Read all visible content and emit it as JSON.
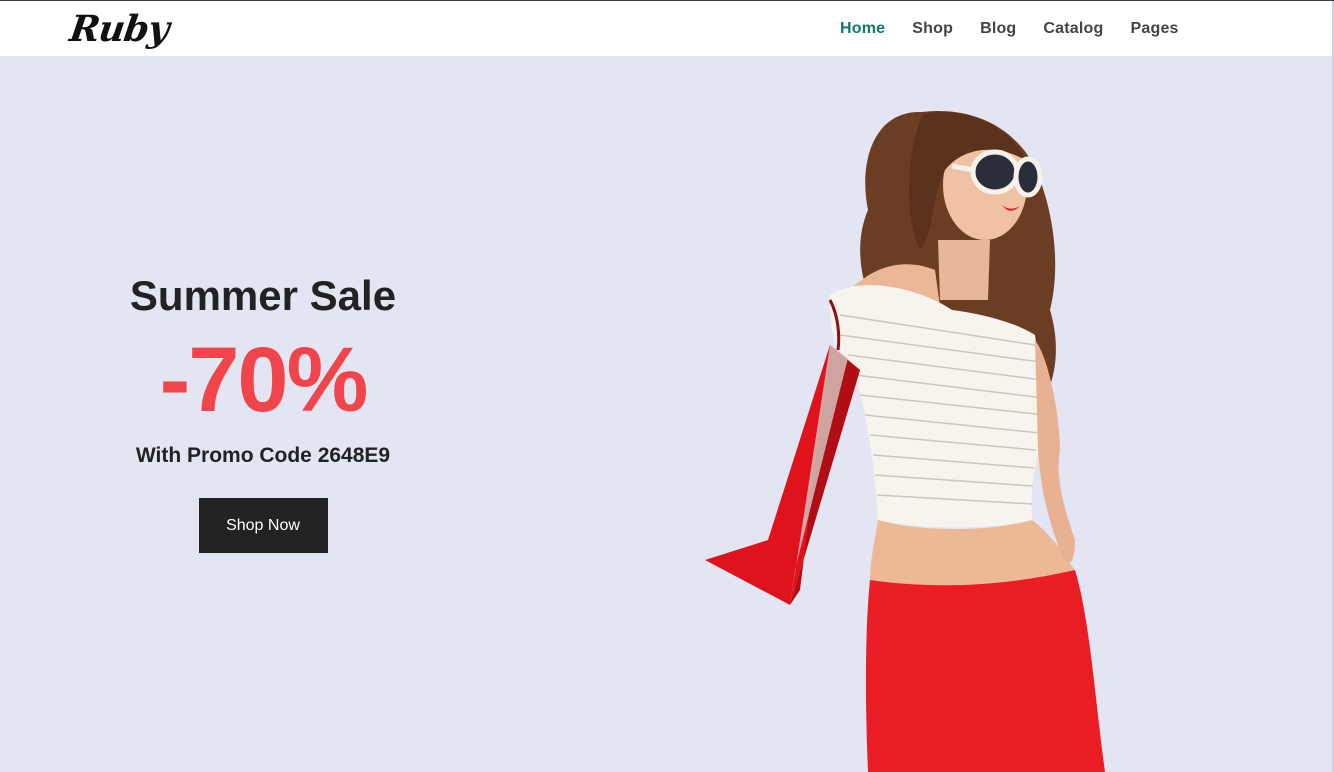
{
  "brand": {
    "logo_text": "Ruby"
  },
  "nav": {
    "items": [
      {
        "label": "Home",
        "active": true
      },
      {
        "label": "Shop",
        "active": false
      },
      {
        "label": "Blog",
        "active": false
      },
      {
        "label": "Catalog",
        "active": false
      },
      {
        "label": "Pages",
        "active": false
      }
    ]
  },
  "hero": {
    "title": "Summer Sale",
    "discount": "-70%",
    "promo": "With Promo Code 2648E9",
    "cta_label": "Shop Now"
  },
  "colors": {
    "background": "#e3e5f3",
    "accent_nav": "#0b7c6b",
    "discount": "#f0454a",
    "button": "#222222",
    "bag": "#e0121b",
    "pants": "#ea1c24"
  },
  "icons": {
    "hero_image": "woman-with-shopping-bag-image"
  }
}
